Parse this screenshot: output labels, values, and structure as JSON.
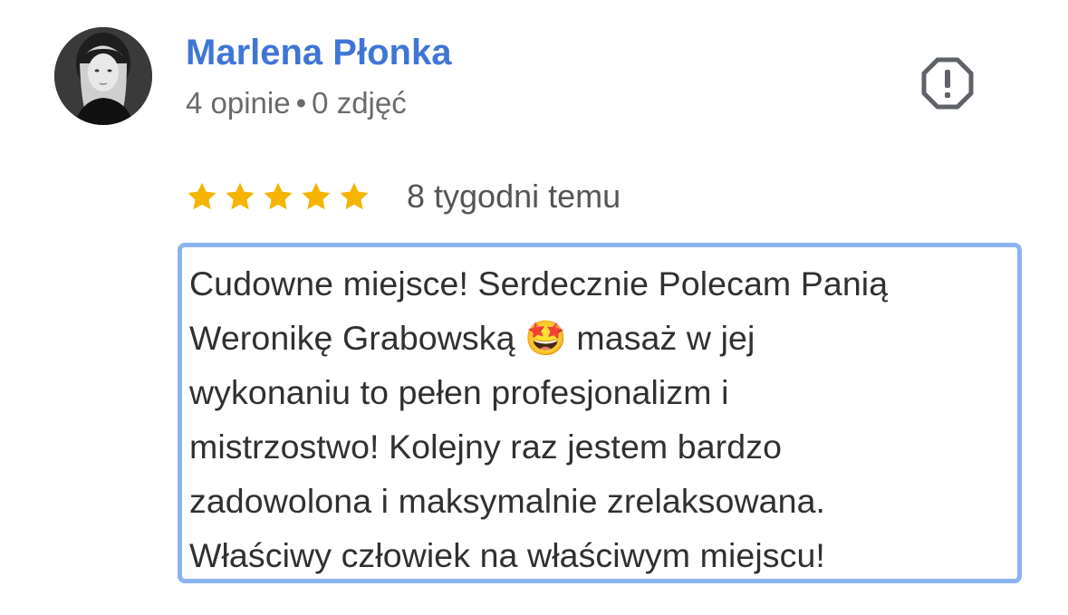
{
  "reviewer": {
    "name": "Marlena Płonka",
    "reviews_count": "4 opinie",
    "separator": "•",
    "photos_count": "0 zdjęć"
  },
  "review": {
    "rating": 5,
    "max_rating": 5,
    "date": "8 tygodni temu",
    "text": "Cudowne miejsce! Serdecznie Polecam Panią\nWeronikę Grabowską 🤩 masaż w jej\nwykonaniu to pełen profesjonalizm i\nmistrzostwo! Kolejny raz jestem bardzo\nzadowolona i maksymalnie zrelaksowana.\nWłaściwy człowiek na właściwym miejscu!"
  },
  "icons": {
    "report": "report-octagon-icon",
    "star": "star-icon"
  },
  "colors": {
    "name": "#3f76d6",
    "meta": "#6b6b6b",
    "star": "#f4b400",
    "highlight_border": "#8ab4f0",
    "text": "#303030"
  }
}
